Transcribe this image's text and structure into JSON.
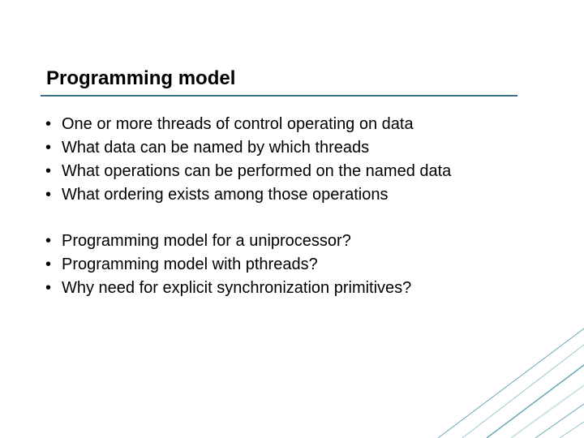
{
  "title": "Programming model",
  "group1": [
    "One or more threads of control operating on data",
    "What data can be named by which threads",
    "What operations can be performed on the named data",
    "What ordering exists among those operations"
  ],
  "group2": [
    "Programming model for a uniprocessor?",
    "Programming model with pthreads?",
    "Why need for explicit synchronization primitives?"
  ]
}
